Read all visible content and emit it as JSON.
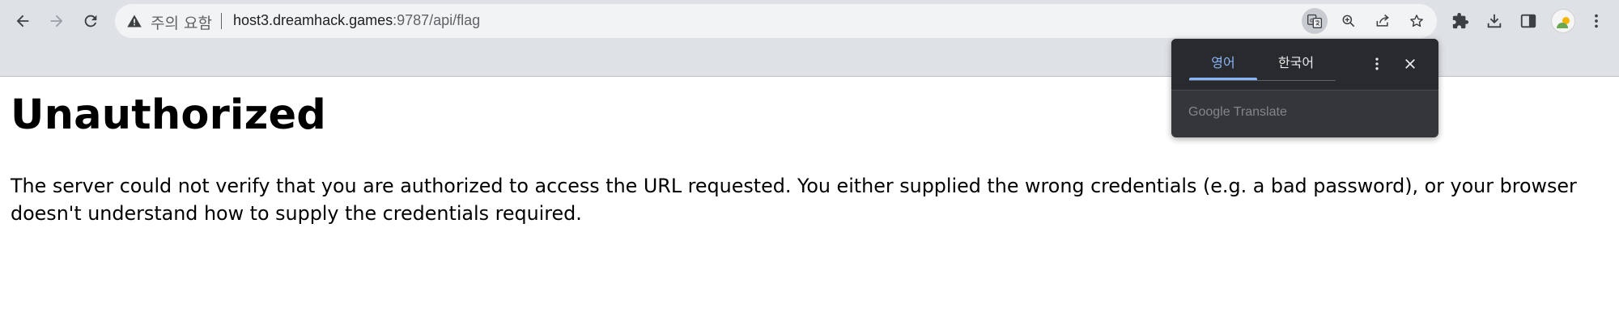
{
  "browser": {
    "security_label": "주의 요함",
    "url_host": "host3.dreamhack.games",
    "url_path": ":9787/api/flag",
    "icons": {
      "back": "arrow-left-icon",
      "forward": "arrow-right-icon",
      "reload": "reload-icon",
      "warning": "warning-triangle-icon",
      "translate": "translate-icon",
      "zoom": "zoom-icon",
      "share": "share-icon",
      "bookmark": "star-icon",
      "extensions": "puzzle-icon",
      "downloads": "download-icon",
      "side_panel": "side-panel-icon",
      "profile": "avatar",
      "menu": "more-vertical-icon"
    }
  },
  "translate_popup": {
    "tab_source": "영어",
    "tab_target": "한국어",
    "footer_google": "Google",
    "footer_translate": "Translate",
    "accent_color": "#8ab4f8",
    "background_color": "#35363a"
  },
  "page": {
    "title": "Unauthorized",
    "message": "The server could not verify that you are authorized to access the URL requested. You either supplied the wrong credentials (e.g. a bad password), or your browser doesn't understand how to supply the credentials required."
  }
}
